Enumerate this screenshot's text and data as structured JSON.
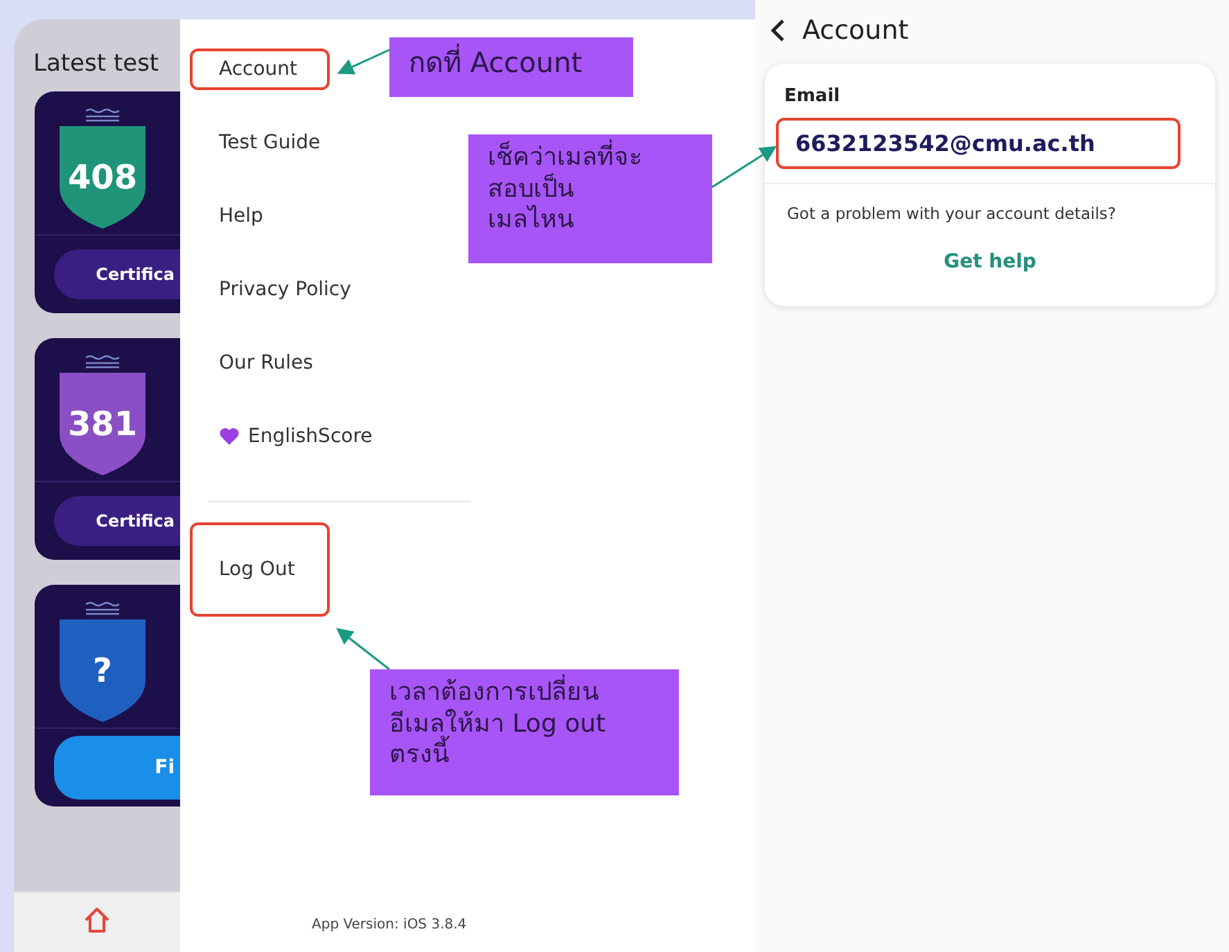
{
  "home_screen": {
    "section_title": "Latest test",
    "cards": [
      {
        "score": "408",
        "color": "#1f9478",
        "button": "Certifica",
        "kind": "certificate"
      },
      {
        "score": "381",
        "color": "#8a4fc4",
        "button": "Certifica",
        "kind": "certificate"
      },
      {
        "score": "?",
        "color": "#1f5fc0",
        "button": "Fi",
        "kind": "primary"
      }
    ]
  },
  "menu": {
    "items": [
      {
        "label": "Account",
        "kind": "plain",
        "highlighted": true
      },
      {
        "label": "Test Guide",
        "kind": "plain",
        "highlighted": false
      },
      {
        "label": "Help",
        "kind": "plain",
        "highlighted": false
      },
      {
        "label": "Privacy Policy",
        "kind": "plain",
        "highlighted": false
      },
      {
        "label": "Our Rules",
        "kind": "plain",
        "highlighted": false
      },
      {
        "label": "EnglishScore",
        "kind": "heart",
        "highlighted": false
      }
    ],
    "logout": {
      "label": "Log Out",
      "highlighted": true
    },
    "app_version": "App Version: iOS 3.8.4"
  },
  "account_screen": {
    "title": "Account",
    "email_label": "Email",
    "email": "6632123542@cmu.ac.th",
    "email_highlighted": true,
    "problem_text": "Got a problem with your account details?",
    "help_link": "Get help"
  },
  "annotations": [
    {
      "text": "กดที่ Account"
    },
    {
      "text": "เช็คว่าเมลที่จะ\nสอบเป็น\nเมลไหน"
    },
    {
      "text": "เวลาต้องการเปลี่ยน\nอีเมลให้มา Log out\nตรงนี้"
    }
  ]
}
